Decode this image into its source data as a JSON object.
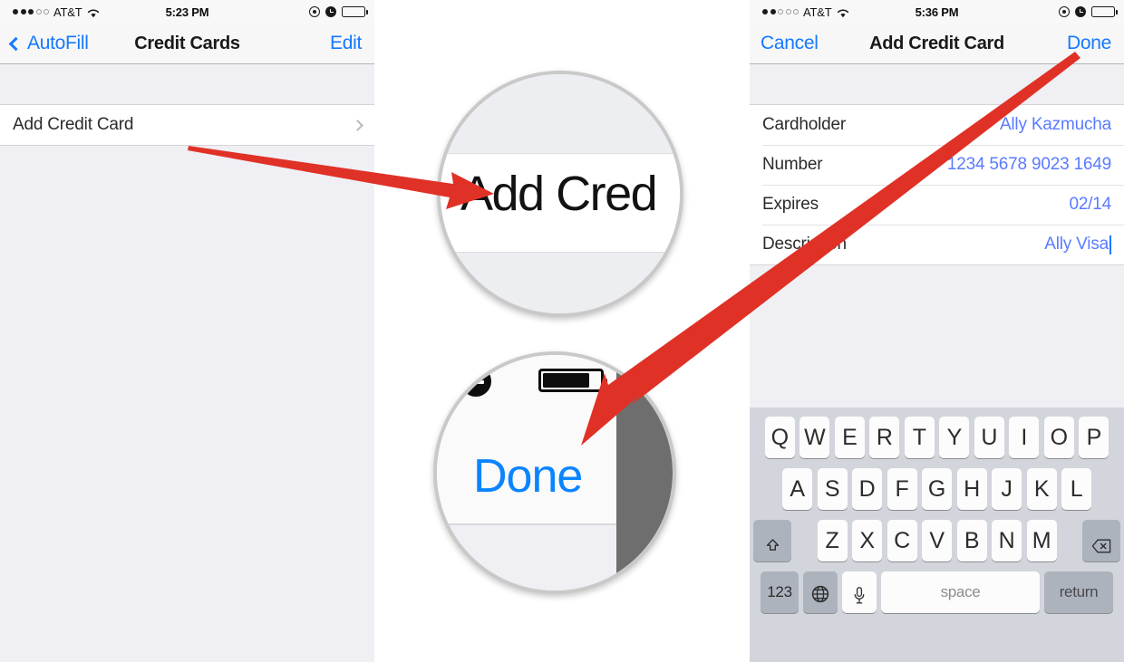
{
  "left_phone": {
    "status_bar": {
      "signal_filled": 3,
      "signal_empty": 2,
      "carrier": "AT&T",
      "wifi_icon": "wifi-icon",
      "time": "5:23 PM",
      "rotation_lock_icon": "rotation-lock-icon",
      "alarm_icon": "alarm-clock-icon",
      "battery_icon": "battery-icon",
      "battery_level": 82
    },
    "nav_bar": {
      "back_label": "AutoFill",
      "back_icon": "chevron-left-icon",
      "title": "Credit Cards",
      "right_label": "Edit"
    },
    "rows": [
      {
        "label": "Add Credit Card",
        "accessory": "chevron-right-icon"
      }
    ]
  },
  "right_phone": {
    "status_bar": {
      "signal_filled": 2,
      "signal_empty": 3,
      "carrier": "AT&T",
      "wifi_icon": "wifi-icon",
      "time": "5:36 PM",
      "rotation_lock_icon": "rotation-lock-icon",
      "alarm_icon": "alarm-clock-icon",
      "battery_icon": "battery-icon",
      "battery_level": 82
    },
    "nav_bar": {
      "left_label": "Cancel",
      "title": "Add Credit Card",
      "right_label": "Done"
    },
    "form_rows": [
      {
        "label": "Cardholder",
        "value": "Ally Kazmucha"
      },
      {
        "label": "Number",
        "value": "1234 5678 9023 1649"
      },
      {
        "label": "Expires",
        "value": "02/14"
      },
      {
        "label": "Description",
        "value": "Ally  Visa",
        "has_caret": true
      }
    ],
    "keyboard": {
      "row1": [
        "Q",
        "W",
        "E",
        "R",
        "T",
        "Y",
        "U",
        "I",
        "O",
        "P"
      ],
      "row2": [
        "A",
        "S",
        "D",
        "F",
        "G",
        "H",
        "J",
        "K",
        "L"
      ],
      "row3_letters": [
        "Z",
        "X",
        "C",
        "V",
        "B",
        "N",
        "M"
      ],
      "shift_icon": "shift-arrow-icon",
      "delete_icon": "delete-backspace-icon",
      "numbers_key": "123",
      "globe_icon": "globe-icon",
      "mic_icon": "microphone-icon",
      "space_key": "space",
      "return_key": "return"
    }
  },
  "magnifiers": [
    {
      "id": "magnifier-add-credit-card",
      "text": "Add Cred"
    },
    {
      "id": "magnifier-done-button",
      "text": "Done",
      "clock_icon": "alarm-clock-icon",
      "battery_icon": "battery-icon"
    }
  ],
  "annotations": {
    "arrow_color": "#e03127",
    "arrow_1": "points from Add Credit Card row to magnified Add Cred",
    "arrow_2": "points from Done button to magnified Done"
  }
}
